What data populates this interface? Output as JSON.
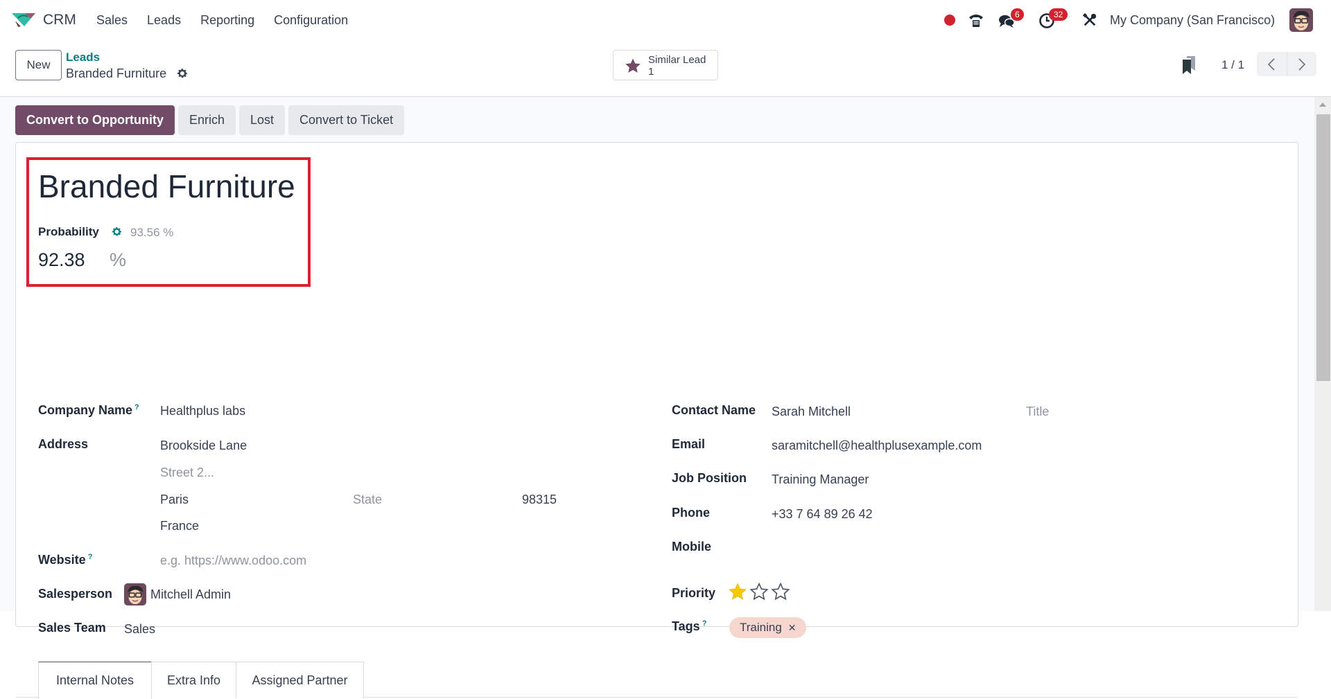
{
  "navbar": {
    "app_name": "CRM",
    "menu": [
      "Sales",
      "Leads",
      "Reporting",
      "Configuration"
    ],
    "icons": {
      "status": "status-dot-icon",
      "phone": "phone-icon",
      "messages": "chat-icon",
      "activities": "clock-icon",
      "settings": "tools-icon"
    },
    "messages_count": "6",
    "activities_count": "32",
    "company": "My Company (San Francisco)",
    "colors": {
      "badge": "#d2222d",
      "status_dot": "#d2222d"
    }
  },
  "control_panel": {
    "new_label": "New",
    "breadcrumb_parent": "Leads",
    "breadcrumb_current": "Branded Furniture",
    "smart_button": {
      "label": "Similar Lead",
      "count": "1"
    },
    "pager": {
      "value": "1 / 1",
      "prev": "<",
      "next": ">"
    }
  },
  "actions": {
    "convert_opportunity": "Convert to Opportunity",
    "enrich": "Enrich",
    "lost": "Lost",
    "convert_ticket": "Convert to Ticket",
    "primary_color": "#714b67"
  },
  "lead": {
    "title": "Branded Furniture",
    "probability_label": "Probability",
    "probability_auto": "93.56 %",
    "probability_value": "92.38",
    "probability_unit": "%"
  },
  "left_fields": {
    "company_name": {
      "label": "Company Name",
      "help": "?",
      "value": "Healthplus labs"
    },
    "address": {
      "label": "Address",
      "street": "Brookside Lane",
      "street2_placeholder": "Street 2...",
      "city": "Paris",
      "state_placeholder": "State",
      "zip": "98315",
      "country": "France"
    },
    "website": {
      "label": "Website",
      "help": "?",
      "placeholder": "e.g. https://www.odoo.com"
    },
    "salesperson": {
      "label": "Salesperson",
      "value": "Mitchell Admin"
    },
    "sales_team": {
      "label": "Sales Team",
      "value": "Sales"
    }
  },
  "right_fields": {
    "contact_name": {
      "label": "Contact Name",
      "value": "Sarah Mitchell",
      "title_placeholder": "Title"
    },
    "email": {
      "label": "Email",
      "value": "saramitchell@healthplusexample.com"
    },
    "job_position": {
      "label": "Job Position",
      "value": "Training Manager"
    },
    "phone": {
      "label": "Phone",
      "value": "+33 7 64 89 26 42"
    },
    "mobile": {
      "label": "Mobile",
      "value": ""
    },
    "priority": {
      "label": "Priority",
      "stars_filled": 1,
      "stars_total": 3,
      "star_color": "#f3cc00"
    },
    "tags": {
      "label": "Tags",
      "help": "?",
      "items": [
        {
          "name": "Training",
          "color": "#f5d7cf"
        }
      ]
    }
  },
  "tabs": [
    "Internal Notes",
    "Extra Info",
    "Assigned Partner"
  ],
  "active_tab": "Internal Notes"
}
